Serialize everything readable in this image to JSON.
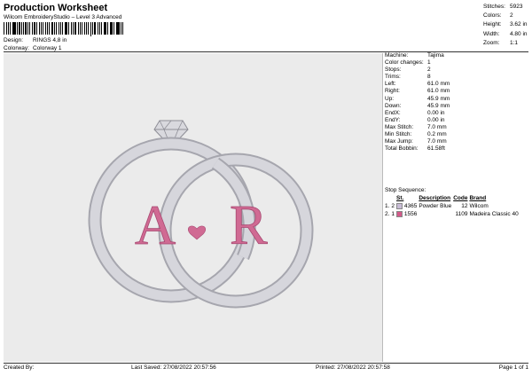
{
  "header": {
    "title": "Production Worksheet",
    "subtitle": "Wilcom EmbroideryStudio – Level 3 Advanced",
    "design_label": "Design:",
    "design_value": "RINGS 4,8 in",
    "colorway_label": "Colorway:",
    "colorway_value": "Colorway 1"
  },
  "stats": [
    {
      "label": "Stitches:",
      "value": "5923"
    },
    {
      "label": "Colors:",
      "value": "2"
    },
    {
      "label": "Height:",
      "value": "3.62 in"
    },
    {
      "label": "Width:",
      "value": "4.80 in"
    },
    {
      "label": "Zoom:",
      "value": "1:1"
    }
  ],
  "machine_info": [
    {
      "label": "Machine:",
      "value": "Tajima"
    },
    {
      "label": "Color changes:",
      "value": "1"
    },
    {
      "label": "Stops:",
      "value": "2"
    },
    {
      "label": "Trims:",
      "value": "8"
    },
    {
      "label": "Left:",
      "value": "61.0 mm"
    },
    {
      "label": "Right:",
      "value": "61.0 mm"
    },
    {
      "label": "Up:",
      "value": "45.9 mm"
    },
    {
      "label": "Down:",
      "value": "45.9 mm"
    },
    {
      "label": "EndX:",
      "value": "0.00 in"
    },
    {
      "label": "EndY:",
      "value": "0.00 in"
    },
    {
      "label": "Max Stitch:",
      "value": "7.0 mm"
    },
    {
      "label": "Min Stitch:",
      "value": "0.2 mm"
    },
    {
      "label": "Max Jump:",
      "value": "7.0 mm"
    },
    {
      "label": "Total Bobbin:",
      "value": "61.58ft"
    }
  ],
  "stop_sequence": {
    "title": "Stop Sequence:",
    "headers": [
      "",
      "",
      "St.",
      "Description",
      "Code",
      "Brand"
    ],
    "rows": [
      {
        "num": "1.",
        "n": "2",
        "color": "#c8bcd6",
        "stitches": "4365",
        "description": "Powder Blue",
        "code": "12",
        "brand": "Wilcom"
      },
      {
        "num": "2.",
        "n": "1",
        "color": "#d25a8a",
        "stitches": "1556",
        "description": "",
        "code": "1109",
        "brand": "Madeira Classic 40"
      }
    ]
  },
  "design": {
    "letter_left": "A",
    "letter_right": "R",
    "ring_color": "#c9c9cf",
    "letter_color": "#d06a93"
  },
  "footer": {
    "created_by": "Created By:",
    "last_saved": "Last Saved: 27/08/2022 20:57:56",
    "printed": "Printed: 27/08/2022 20:57:58",
    "page": "Page 1 of 1"
  }
}
